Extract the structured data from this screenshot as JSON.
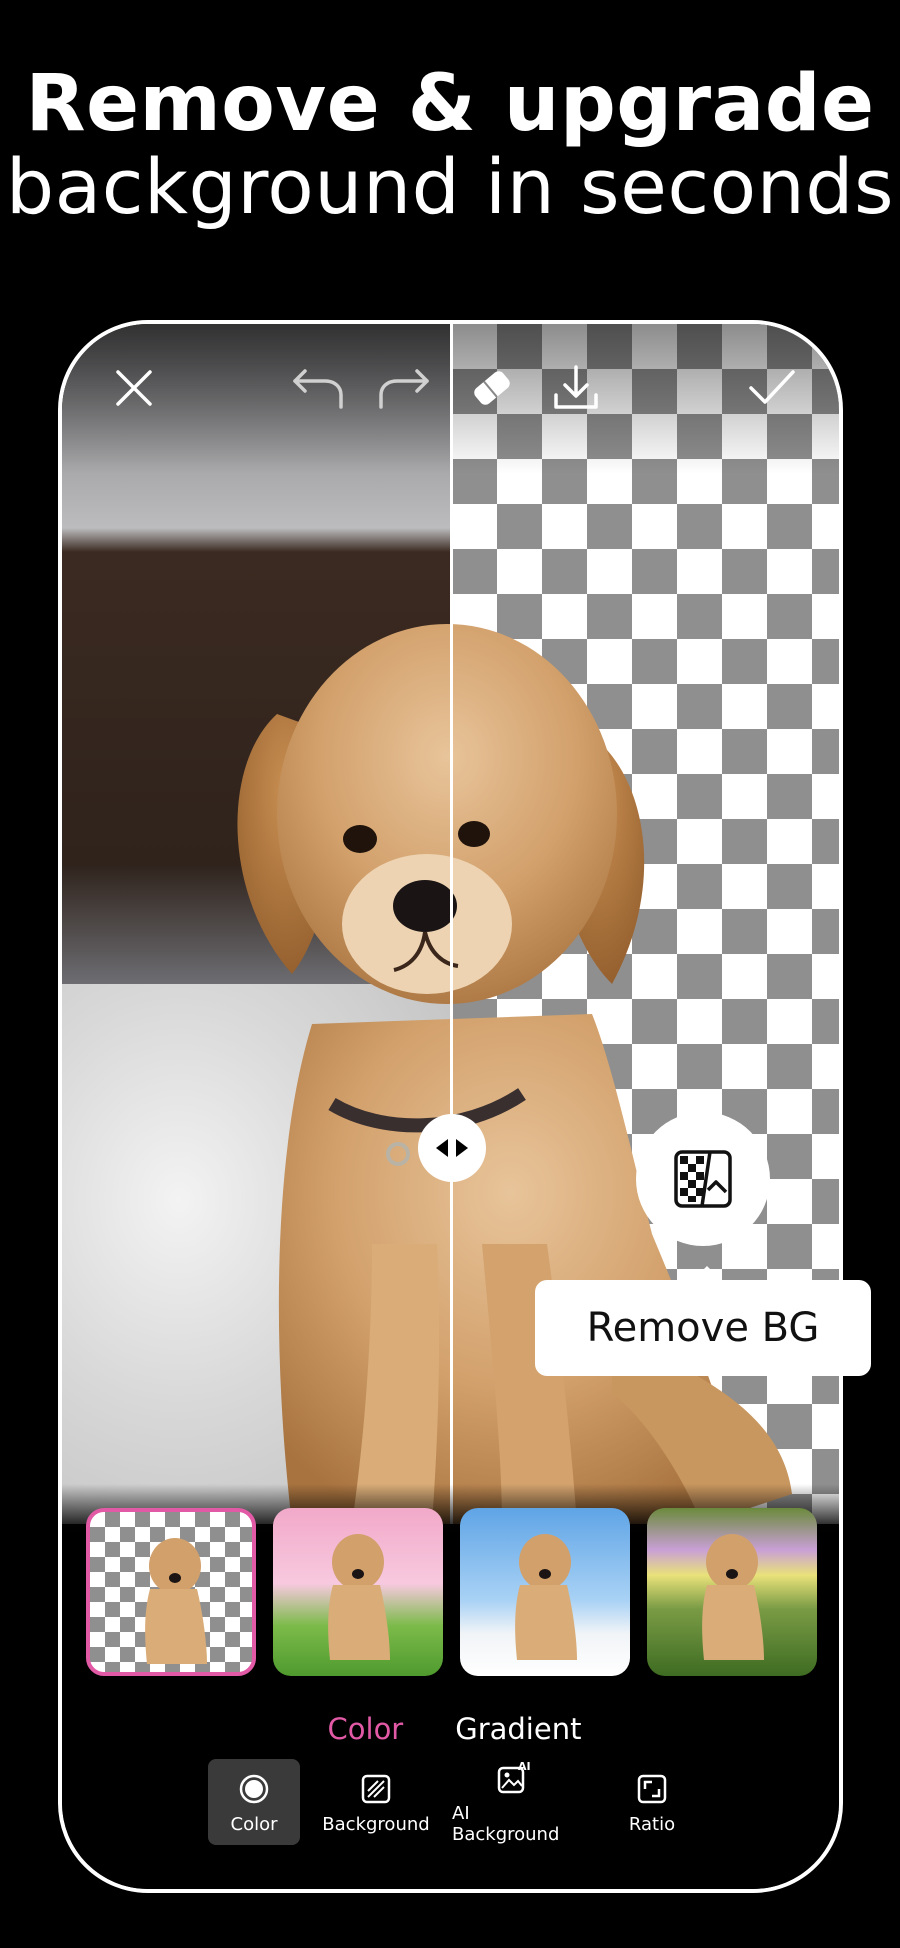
{
  "headline": {
    "line1": "Remove & upgrade",
    "line2": "background in seconds"
  },
  "toolbar": {
    "icons": [
      "close-icon",
      "undo-icon",
      "redo-icon",
      "eraser-icon",
      "download-icon",
      "checkmark-icon"
    ]
  },
  "compare_handle_icon": "compare-arrows-icon",
  "remove_bg": {
    "icon": "remove-bg-icon",
    "label": "Remove BG"
  },
  "thumbnails": [
    {
      "name": "transparent",
      "selected": true
    },
    {
      "name": "pink-meadow",
      "selected": false
    },
    {
      "name": "sky-clouds",
      "selected": false
    },
    {
      "name": "flower-garden",
      "selected": false
    }
  ],
  "tabs": [
    {
      "label": "Color",
      "active": true
    },
    {
      "label": "Gradient",
      "active": false
    }
  ],
  "tools": [
    {
      "label": "Color",
      "icon": "color-circle-icon",
      "active": true
    },
    {
      "label": "Background",
      "icon": "background-pattern-icon",
      "active": false
    },
    {
      "label": "AI Background",
      "icon": "ai-background-icon",
      "active": false
    },
    {
      "label": "Ratio",
      "icon": "ratio-icon",
      "active": false
    }
  ],
  "colors": {
    "accent": "#e25aa6",
    "background": "#000000",
    "frame": "#ffffff"
  }
}
